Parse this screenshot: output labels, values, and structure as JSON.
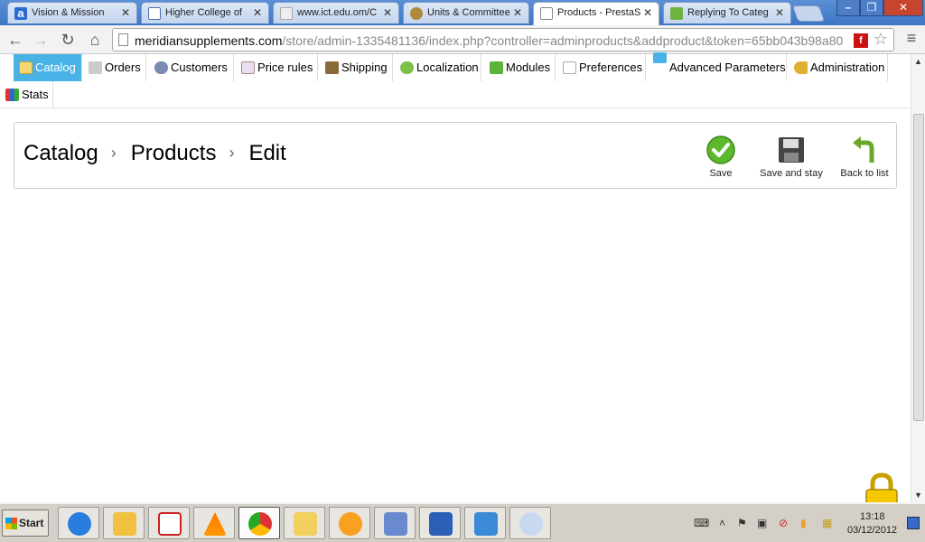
{
  "browser": {
    "tabs": [
      {
        "label": "Vision & Mission",
        "active": false
      },
      {
        "label": "Higher College of",
        "active": false
      },
      {
        "label": "www.ict.edu.om/C",
        "active": false
      },
      {
        "label": "Units & Committee",
        "active": false
      },
      {
        "label": "Products - PrestaS",
        "active": true
      },
      {
        "label": "Replying To Categ",
        "active": false
      }
    ],
    "url_host": "meridiansupplements.com",
    "url_path": "/store/admin-1335481136/index.php?controller=adminproducts&addproduct&token=65bb043b98a80",
    "window_buttons": [
      "–",
      "❐",
      "✕"
    ]
  },
  "admin_menu": {
    "items": [
      {
        "label": "Catalog",
        "active": true
      },
      {
        "label": "Orders"
      },
      {
        "label": "Customers"
      },
      {
        "label": "Price rules"
      },
      {
        "label": "Shipping"
      },
      {
        "label": "Localization"
      },
      {
        "label": "Modules"
      },
      {
        "label": "Preferences"
      },
      {
        "label": "Advanced Parameters"
      },
      {
        "label": "Administration"
      },
      {
        "label": "Stats"
      }
    ]
  },
  "header": {
    "breadcrumb": [
      "Catalog",
      "Products",
      "Edit"
    ],
    "separator": "›",
    "actions": {
      "save": "Save",
      "save_and_stay": "Save and stay",
      "back_to_list": "Back to list"
    }
  },
  "taskbar": {
    "start_label": "Start",
    "clock_time": "13:18",
    "clock_date": "03/12/2012"
  },
  "colors": {
    "menu_active": "#49b2e7",
    "tab_strip": "#4a82cc",
    "save_green": "#5cb82c"
  }
}
